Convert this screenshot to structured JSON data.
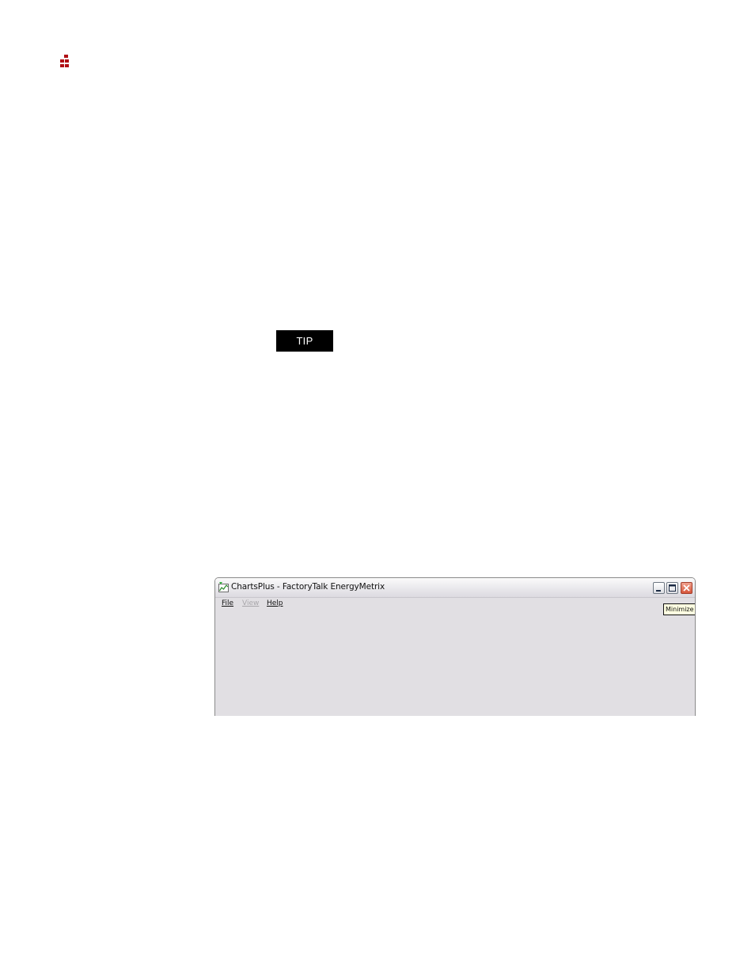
{
  "page": {
    "tip_label": "TIP"
  },
  "window": {
    "title": "ChartsPlus - FactoryTalk EnergyMetrix",
    "menu": [
      {
        "label": "File",
        "enabled": true
      },
      {
        "label": "View",
        "enabled": false
      },
      {
        "label": "Help",
        "enabled": true
      }
    ],
    "tooltip": "Minimize"
  },
  "icons": {
    "logo": "red-dots-logo",
    "app": "chartsplus-app-icon",
    "minimize": "minimize-icon",
    "maximize": "maximize-icon",
    "close": "close-icon"
  },
  "colors": {
    "logo_red": "#b01116",
    "tip_bg": "#000000",
    "window_bg": "#e1dfe3",
    "tooltip_bg": "#ffffe1",
    "close_button": "#d6553a"
  }
}
